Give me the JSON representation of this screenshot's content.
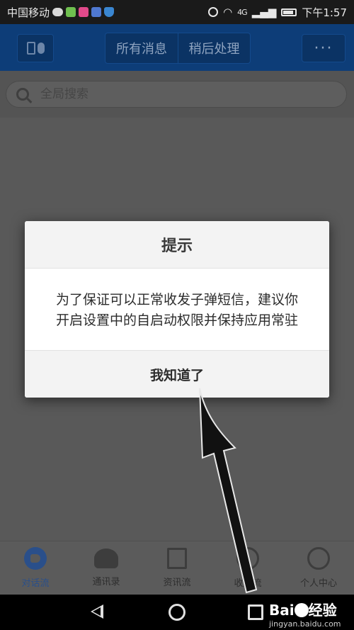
{
  "status_bar": {
    "carrier": "中国移动",
    "time": "下午1:57",
    "network_label": "4G"
  },
  "header": {
    "tabs": [
      {
        "label": "所有消息"
      },
      {
        "label": "稍后处理"
      }
    ],
    "more_label": "···"
  },
  "search": {
    "placeholder": "全局搜索"
  },
  "dialog": {
    "title": "提示",
    "message_line1": "为了保证可以正常收发子弹短信，建议你",
    "message_line2": "开启设置中的自启动权限并保持应用常驻",
    "confirm_label": "我知道了"
  },
  "bottom_nav": {
    "items": [
      {
        "label": "对话流",
        "icon": "chat-flow-icon",
        "active": true
      },
      {
        "label": "通讯录",
        "icon": "contacts-icon",
        "active": false
      },
      {
        "label": "资讯流",
        "icon": "news-icon",
        "active": false
      },
      {
        "label": "收藏流",
        "icon": "favorites-icon",
        "active": false
      },
      {
        "label": "个人中心",
        "icon": "user-icon",
        "active": false
      }
    ]
  },
  "watermark": {
    "logo": "Bai",
    "logo_suffix": "经验",
    "url": "jingyan.baidu.com"
  },
  "colors": {
    "header_bg": "#0d3d78",
    "active_nav": "#2a4f8a",
    "dialog_bg": "#ffffff"
  }
}
